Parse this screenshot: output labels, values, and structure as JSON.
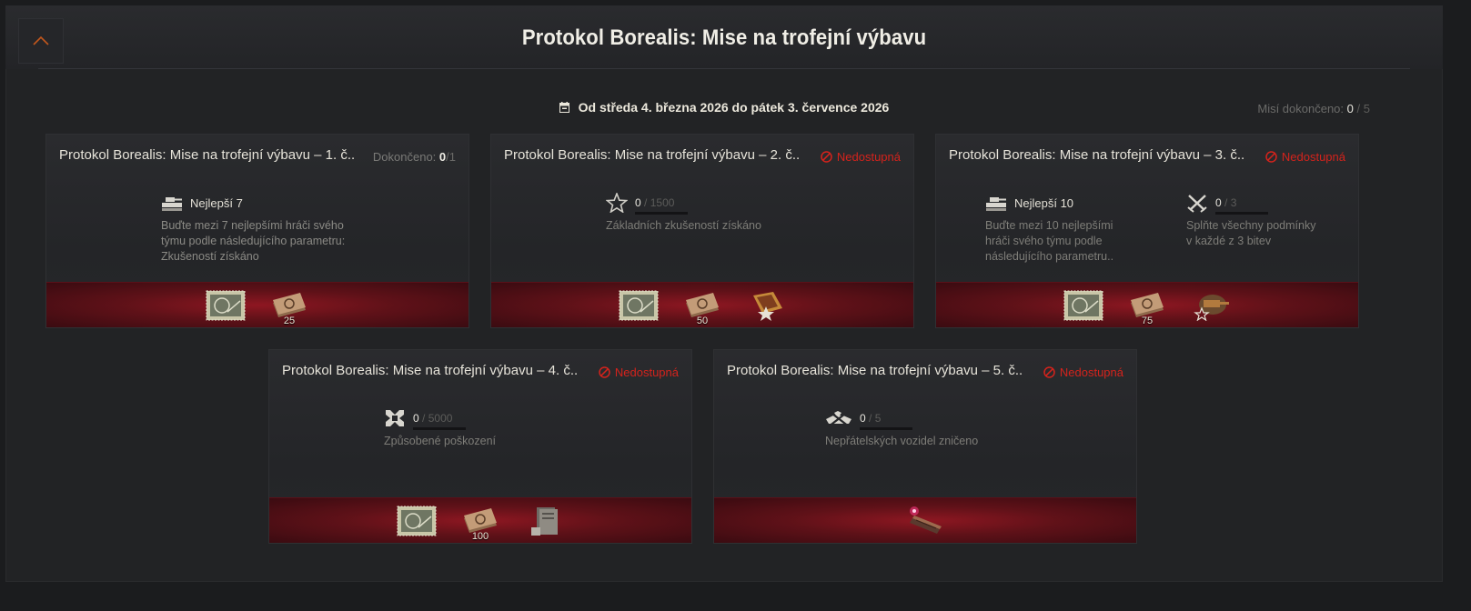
{
  "header": {
    "title": "Protokol Borealis: Mise na trofejní výbavu",
    "collapse_icon": "chevron-up-icon"
  },
  "period": {
    "text": "Od středa 4. března 2026 do pátek 3. července 2026",
    "icon": "calendar-icon"
  },
  "missions_completed": {
    "label": "Misí dokončeno:",
    "current": "0",
    "separator": "/",
    "total": "5"
  },
  "colors": {
    "accent_red": "#d4231c",
    "reward_band": "#8a0f1c",
    "chevron": "#c2571c"
  },
  "cards": [
    {
      "title": "Protokol Borealis: Mise na trofejní výbavu – 1. č..",
      "status_label": "Dokončeno:",
      "status_current": "0",
      "status_total": "/1",
      "conditions": [
        {
          "icon": "tank-top-icon",
          "name": "Nejlepší 7",
          "desc_lines": [
            "Buďte mezi 7 nejlepšími hráči svého",
            "týmu podle následujícího parametru:",
            "Zkušeností získáno"
          ]
        }
      ],
      "rewards": [
        {
          "icon": "stamp-icon",
          "count": ""
        },
        {
          "icon": "bond-stack-icon",
          "count": "25"
        }
      ]
    },
    {
      "title": "Protokol Borealis: Mise na trofejní výbavu – 2. č..",
      "unavailable": "Nedostupná",
      "conditions": [
        {
          "icon": "star-icon",
          "progress_current": "0",
          "progress_sep": "/",
          "progress_max": "1500",
          "desc_lines": [
            "Základních zkušeností získáno"
          ]
        }
      ],
      "rewards": [
        {
          "icon": "stamp-icon",
          "count": ""
        },
        {
          "icon": "bond-stack-icon",
          "count": "50"
        },
        {
          "icon": "medal-badge-icon",
          "count": ""
        }
      ]
    },
    {
      "title": "Protokol Borealis: Mise na trofejní výbavu – 3. č..",
      "unavailable": "Nedostupná",
      "conditions": [
        {
          "icon": "tank-top-icon",
          "name": "Nejlepší 10",
          "desc_lines": [
            "Buďte mezi 10 nejlepšími",
            "hráči svého týmu podle",
            "následujícího parametru.."
          ]
        },
        {
          "icon": "crossed-swords-icon",
          "progress_current": "0",
          "progress_sep": "/",
          "progress_max": "3",
          "desc_lines": [
            "Splňte všechny podmínky",
            "v každé z 3 bitev"
          ]
        }
      ],
      "rewards": [
        {
          "icon": "stamp-icon",
          "count": ""
        },
        {
          "icon": "bond-stack-icon",
          "count": "75"
        },
        {
          "icon": "tank-decal-icon",
          "count": ""
        }
      ]
    },
    {
      "title": "Protokol Borealis: Mise na trofejní výbavu – 4. č..",
      "unavailable": "Nedostupná",
      "conditions": [
        {
          "icon": "damage-cross-icon",
          "progress_current": "0",
          "progress_sep": "/",
          "progress_max": "5000",
          "desc_lines": [
            "Způsobené poškození"
          ]
        }
      ],
      "rewards": [
        {
          "icon": "stamp-icon",
          "count": ""
        },
        {
          "icon": "bond-stack-icon",
          "count": "100"
        },
        {
          "icon": "manual-book-icon",
          "count": ""
        }
      ]
    },
    {
      "title": "Protokol Borealis: Mise na trofejní výbavu – 5. č..",
      "unavailable": "Nedostupná",
      "conditions": [
        {
          "icon": "destroyed-vehicle-icon",
          "progress_current": "0",
          "progress_sep": "/",
          "progress_max": "5",
          "desc_lines": [
            "Nepřátelských vozidel zničeno"
          ]
        }
      ],
      "rewards": [
        {
          "icon": "glowing-device-icon",
          "count": ""
        }
      ]
    }
  ]
}
